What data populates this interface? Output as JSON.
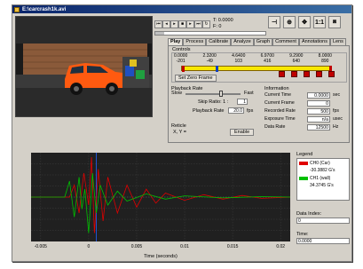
{
  "window": {
    "title": "E:\\carcrash1k.avi"
  },
  "toolbar": {
    "time_label": "T: 0.0000",
    "frame_label": "F: 0",
    "zoom_label": "1:1",
    "buttons": [
      "skip-start",
      "step-back",
      "play",
      "stop",
      "step-forward",
      "skip-end",
      "loop"
    ]
  },
  "tabs": [
    "Play",
    "Process",
    "Calibrate",
    "Analyze",
    "Graph",
    "Comment",
    "Annotations",
    "Lens"
  ],
  "controls": {
    "label": "Controls",
    "times": [
      "0.0000",
      "2.3200",
      "4.6400",
      "6.9700",
      "9.2900",
      "8.0000"
    ],
    "frames": [
      "-201",
      "-49",
      "103",
      "416",
      "640",
      "890"
    ],
    "set_zero_label": "Set Zero Frame"
  },
  "playback": {
    "label": "Playback Rate",
    "slow": "Slow",
    "fast": "Fast",
    "skip_ratio_label": "Skip Ratio: 1 :",
    "skip_ratio_value": "1",
    "playback_rate_label": "Playback Rate",
    "playback_rate_value": "20.0",
    "playback_rate_unit": "fps"
  },
  "reticle": {
    "label": "Reticle",
    "xy_label": "X, Y =",
    "enable_label": "Enable"
  },
  "information": {
    "label": "Information",
    "rows": [
      {
        "label": "Current Time",
        "value": "0.0000",
        "unit": "sec"
      },
      {
        "label": "Current Frame",
        "value": "0",
        "unit": ""
      },
      {
        "label": "Recorded Rate",
        "value": "500",
        "unit": "fps"
      },
      {
        "label": "Exposure Time",
        "value": "n/a",
        "unit": "usec"
      },
      {
        "label": "Data Rate",
        "value": "12500",
        "unit": "Hz"
      }
    ]
  },
  "legend": {
    "title": "Legend",
    "items": [
      {
        "name": "CH0 (Car)",
        "value": "-30.3882 G's",
        "color": "#e00000"
      },
      {
        "name": "CH1 (wall)",
        "value": "34.3745 G's",
        "color": "#00c000"
      }
    ]
  },
  "data_index": {
    "label": "Data Index:",
    "value": "0"
  },
  "time_field": {
    "label": "Time:",
    "value": "0.0000"
  },
  "chart_data": {
    "type": "line",
    "xlabel": "Time (seconds)",
    "xlim": [
      -0.006,
      0.021
    ],
    "x_ticks": [
      "-0.005",
      "0",
      "0.005",
      "0.01",
      "0.015",
      "0.02"
    ],
    "grid": true,
    "series": [
      {
        "name": "CH0 (Car)",
        "color": "#e00000",
        "x": [
          -0.006,
          -0.002,
          -0.0015,
          -0.001,
          -0.0005,
          0.0,
          0.0003,
          0.0006,
          0.001,
          0.0015,
          0.002,
          0.003,
          0.004,
          0.005,
          0.006,
          0.007,
          0.008,
          0.01,
          0.012,
          0.014,
          0.016,
          0.018,
          0.021
        ],
        "y": [
          0,
          0,
          0.3,
          -0.4,
          0.6,
          -0.2,
          1.0,
          -0.9,
          0.7,
          -0.6,
          0.5,
          -0.4,
          0.3,
          -0.25,
          0.2,
          -0.15,
          0.1,
          -0.08,
          0.06,
          -0.05,
          0.04,
          -0.03,
          0
        ]
      },
      {
        "name": "CH1 (wall)",
        "color": "#00c000",
        "x": [
          -0.006,
          -0.0025,
          -0.002,
          -0.0015,
          -0.001,
          -0.0007,
          -0.0004,
          0.0,
          0.0004,
          0.0008,
          0.0012,
          0.002,
          0.003,
          0.004,
          0.006,
          0.008,
          0.01,
          0.014,
          0.018,
          0.021
        ],
        "y": [
          0,
          0,
          0.4,
          -0.5,
          0.5,
          -0.3,
          0.2,
          -0.9,
          0.6,
          -0.4,
          0.3,
          -0.2,
          0.15,
          -0.1,
          0.08,
          -0.05,
          0.03,
          -0.02,
          0.01,
          0
        ]
      }
    ]
  }
}
